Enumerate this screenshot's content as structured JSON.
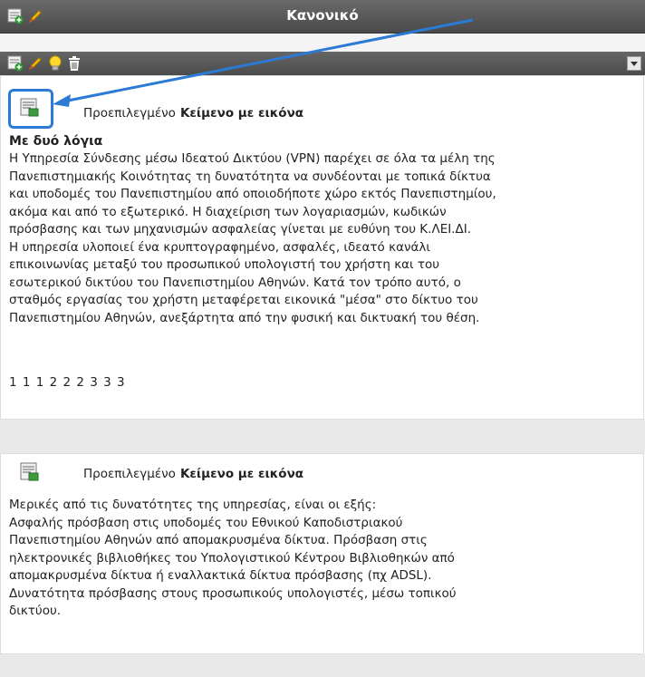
{
  "top_bar": {
    "title": "Κανονικό"
  },
  "block1": {
    "label": "Προεπιλεγμένο",
    "type": "Κείμενο με εικόνα",
    "heading": "Με δυό λόγια",
    "lines": [
      "Η Υπηρεσία Σύνδεσης μέσω Ιδεατού Δικτύου (VPN) παρέχει σε όλα τα μέλη της",
      "Πανεπιστημιακής Κοινότητας τη δυνατότητα να συνδέονται με τοπικά δίκτυα",
      "και υποδομές του Πανεπιστημίου από οποιοδήποτε χώρο εκτός Πανεπιστημίου,",
      "ακόμα και από το εξωτερικό. Η διαχείριση των λογαριασμών, κωδικών",
      "πρόσβασης και των μηχανισμών ασφαλείας γίνεται με ευθύνη του Κ.ΛΕΙ.ΔΙ.",
      "Η υπηρεσία υλοποιεί ένα κρυπτογραφημένο, ασφαλές, ιδεατό κανάλι",
      "επικοινωνίας μεταξύ του προσωπικού υπολογιστή του χρήστη και του",
      "εσωτερικού δικτύου του Πανεπιστημίου Αθηνών. Κατά τον τρόπο αυτό, ο",
      "σταθμός εργασίας του χρήστη μεταφέρεται εικονικά \"μέσα\" στο δίκτυο του",
      "Πανεπιστημίου Αθηνών, ανεξάρτητα από την φυσική και δικτυακή του θέση."
    ],
    "numbers": "1 1 1 2 2 2 3 3 3"
  },
  "block2": {
    "label": "Προεπιλεγμένο",
    "type": "Κείμενο με εικόνα",
    "lines": [
      "Μερικές από τις δυνατότητες της υπηρεσίας, είναι οι εξής:",
      "Ασφαλής πρόσβαση στις υποδομές του Εθνικού Καποδιστριακού",
      "Πανεπιστημίου Αθηνών από απομακρυσμένα δίκτυα. Πρόσβαση στις",
      "ηλεκτρονικές βιβλιοθήκες του Υπολογιστικού Κέντρου Βιβλιοθηκών από",
      "απομακρυσμένα δίκτυα ή εναλλακτικά δίκτυα πρόσβασης (πχ ADSL).",
      "Δυνατότητα πρόσβασης στους προσωπικούς υπολογιστές, μέσω τοπικού",
      "δικτύου."
    ]
  },
  "icons": {
    "add": "add-block-icon",
    "edit": "pencil-icon",
    "tip": "lightbulb-icon",
    "delete": "trash-icon",
    "block_type": "text-with-image-icon",
    "menu": "dropdown-icon"
  },
  "colors": {
    "highlight": "#2b7ad6",
    "bar": "#555555"
  }
}
